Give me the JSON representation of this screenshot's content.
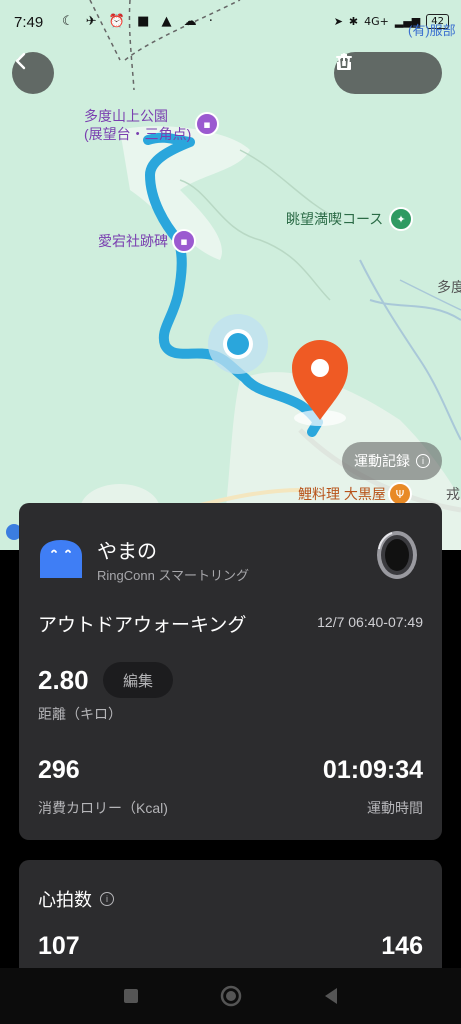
{
  "status_bar": {
    "time": "7:49",
    "battery": "42",
    "network": "4G+"
  },
  "map": {
    "labels": {
      "park": "多度山上公園",
      "park_sub": "(展望台・三角点)",
      "shrine": "愛宕社跡碑",
      "course": "眺望満喫コース",
      "place_edge": "多度",
      "restaurant": "鯉料理 大黒屋",
      "top_right": "(有)服部",
      "edge_right": "戎"
    },
    "record_label": "運動記録"
  },
  "icons": {
    "back": "back-arrow-icon",
    "share": "share-icon",
    "delete": "trash-icon"
  },
  "summary": {
    "user_name": "やまの",
    "device": "RingConn スマートリング",
    "activity": "アウトドアウォーキング",
    "date_time": "12/7 06:40-07:49",
    "distance": "2.80",
    "edit_label": "編集",
    "distance_label": "距離（キロ）",
    "calories": "296",
    "calories_label": "消費カロリー（Kcal)",
    "duration": "01:09:34",
    "duration_label": "運動時間"
  },
  "heart_rate": {
    "title": "心拍数",
    "min": "107",
    "max": "146"
  },
  "colors": {
    "route": "#2aa6dc",
    "pin": "#ef5a24",
    "card_bg": "#2c2c2e",
    "map_bg": "#cfeedd"
  }
}
